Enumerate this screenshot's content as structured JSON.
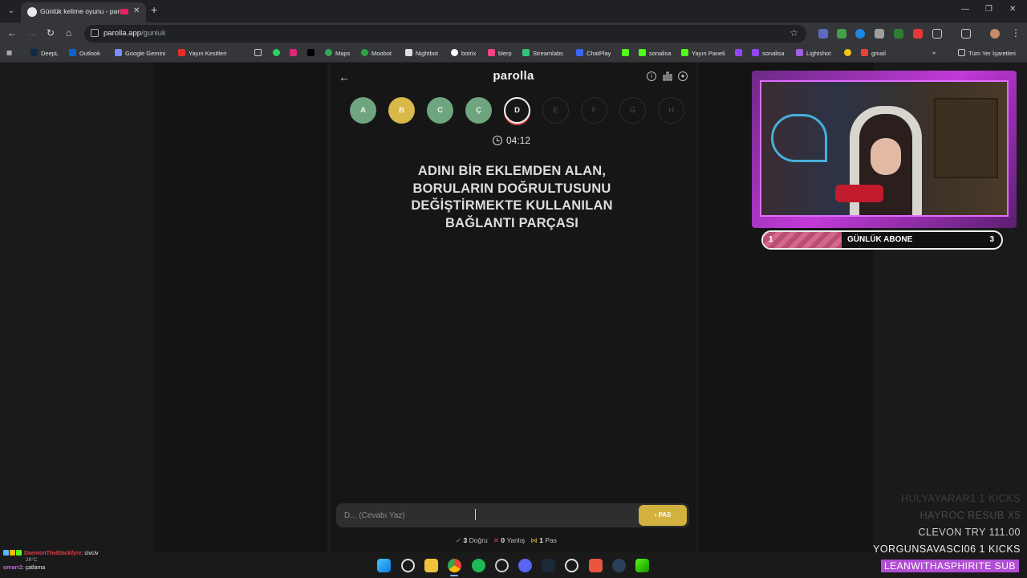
{
  "browser": {
    "tab_title": "Günlük kelime oyunu - paro",
    "url_domain": "parolla.app",
    "url_path": "/gunluk",
    "bookmarks": [
      "DeepL",
      "Outlook",
      "Google Gemini",
      "Yayın Kesitleri",
      "Maps",
      "Moobot",
      "Nightbot",
      "botrix",
      "blerp",
      "Streamlabs",
      "ChatPlay",
      "sonalisa",
      "Yayın Paneli",
      "sonalisa",
      "Lightshot",
      "gmail"
    ],
    "all_bookmarks_label": "Tüm Yer İşaretleri"
  },
  "app": {
    "brand": "parolla",
    "letters": [
      {
        "char": "A",
        "state": "done"
      },
      {
        "char": "B",
        "state": "pass"
      },
      {
        "char": "C",
        "state": "done"
      },
      {
        "char": "Ç",
        "state": "done"
      },
      {
        "char": "D",
        "state": "current"
      },
      {
        "char": "E",
        "state": "pending"
      },
      {
        "char": "F",
        "state": "pending"
      },
      {
        "char": "G",
        "state": "pending"
      },
      {
        "char": "H",
        "state": "pending"
      }
    ],
    "timer": "04:12",
    "question": "ADINI BİR EKLEMDEN ALAN, BORULARIN DOĞRULTUSUNU DEĞİŞTİRMEKTE KULLANILAN BAĞLANTI PARÇASI",
    "answer_placeholder": "D... (Cevabı Yaz)",
    "pass_label": "PAS",
    "stats": {
      "correct_count": "3",
      "correct_label": "Doğru",
      "wrong_count": "0",
      "wrong_label": "Yanlış",
      "pass_count": "1",
      "pass_label": "Pas"
    }
  },
  "overlay": {
    "sub_goal_current": "1",
    "sub_goal_label": "GÜNLÜK ABONE",
    "sub_goal_target": "3",
    "sub_goal_progress": 0.33,
    "alerts": [
      "HULYAYARAR1 1 KICKS",
      "HAYROC RESUB X5",
      "CLEVON TRY 111.00",
      "YORGUNSAVASCI06 1 KICKS",
      "LEANWITHASPHIRITE SUB"
    ],
    "chat": [
      {
        "user": "DaemonTheBlackfyre",
        "message": "civciv"
      },
      {
        "user": "omarr2",
        "message": "çatlama"
      }
    ],
    "weather": "26°C"
  },
  "colors": {
    "done": "#6ea57f",
    "pass": "#d8b848",
    "current_ring": "#f0f0f0",
    "overlay_purple": "#b14ed4"
  }
}
